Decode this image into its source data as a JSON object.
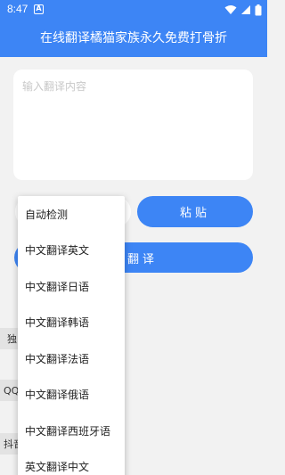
{
  "statusbar": {
    "time": "8:47",
    "notif_letter": "A",
    "icons": [
      "wifi-icon",
      "signal-icon",
      "battery-icon"
    ]
  },
  "header": {
    "title": "在线翻译橘猫家族永久免费打骨折"
  },
  "input": {
    "placeholder": "输入翻译内容",
    "value": ""
  },
  "buttons": {
    "paste_label": "粘贴",
    "translate_label": "翻译"
  },
  "dropdown": {
    "options": [
      "自动检测",
      "中文翻译英文",
      "中文翻译日语",
      "中文翻译韩语",
      "中文翻译法语",
      "中文翻译俄语",
      "中文翻译西班牙语",
      "英文翻译中文"
    ]
  },
  "side_chips": [
    "独",
    "QQ自",
    "抖音"
  ],
  "colors": {
    "primary": "#3d85f5",
    "background": "#f2f2f2"
  }
}
